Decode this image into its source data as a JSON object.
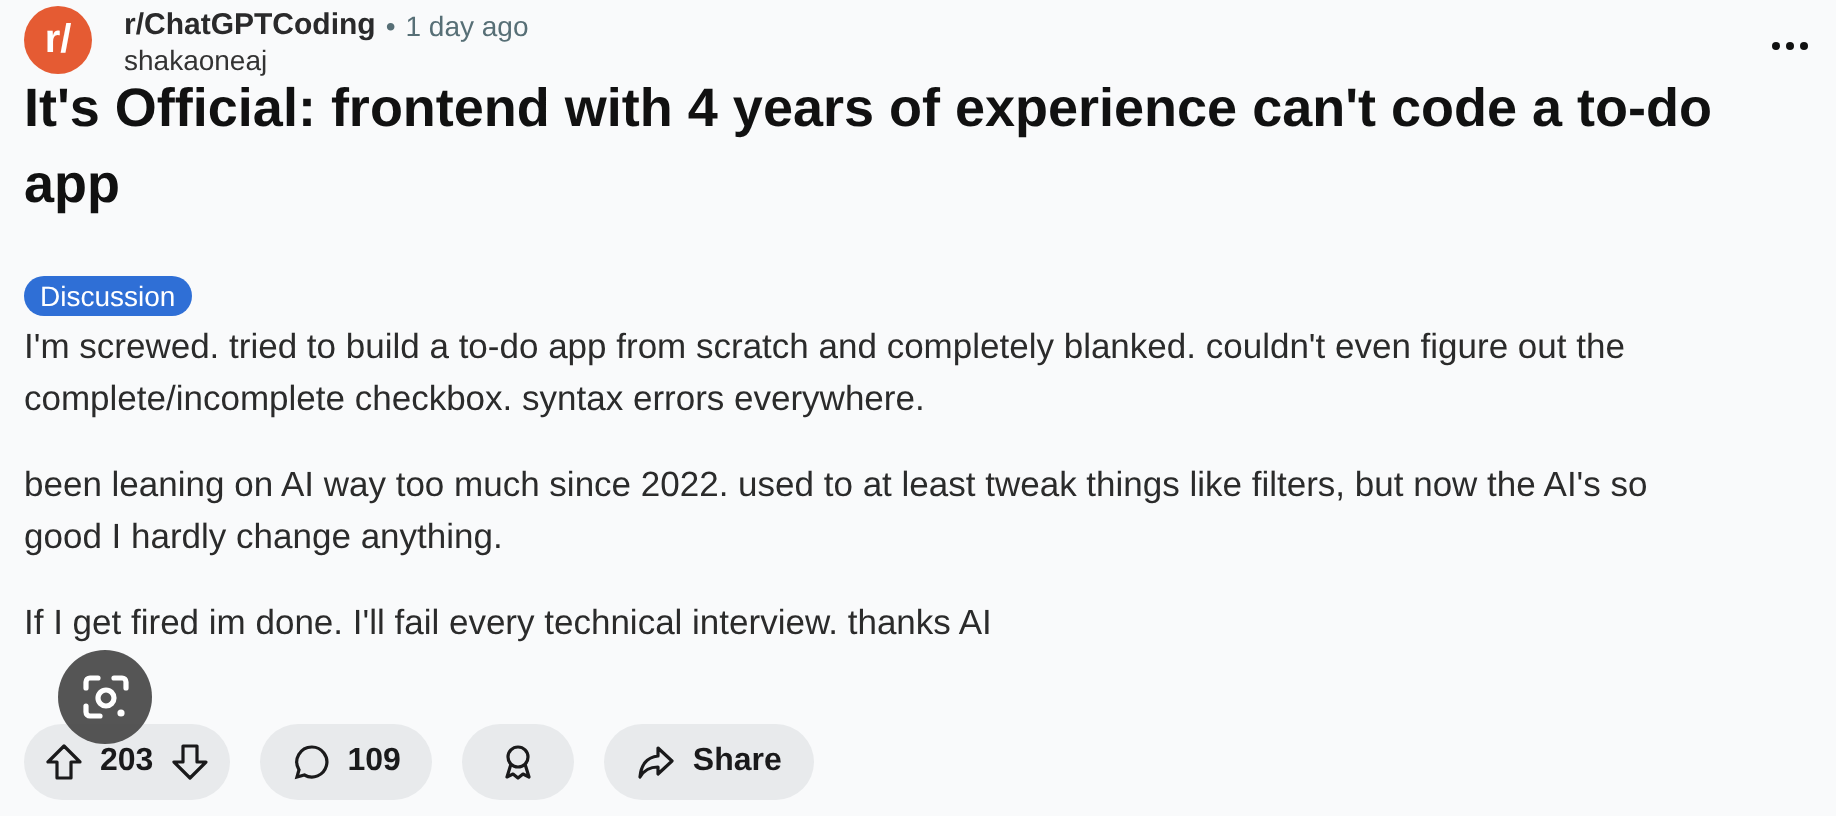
{
  "post": {
    "avatar_text": "r/",
    "community": "r/ChatGPTCoding",
    "separator": "•",
    "time": "1 day ago",
    "author": "shakaoneaj",
    "title": "It's Official: frontend with 4 years of experience can't code a to-do app",
    "flair": "Discussion",
    "paragraphs": [
      "I'm screwed. tried to build a to-do app from scratch and completely blanked. couldn't even figure out the complete/incomplete checkbox. syntax errors everywhere.",
      "been leaning on AI way too much since 2022. used to at least tweak things like filters, but now the AI's so good I hardly change anything.",
      "If I get fired im done. I'll fail every technical interview. thanks AI"
    ]
  },
  "actions": {
    "votes": "203",
    "comments": "109",
    "share": "Share"
  }
}
